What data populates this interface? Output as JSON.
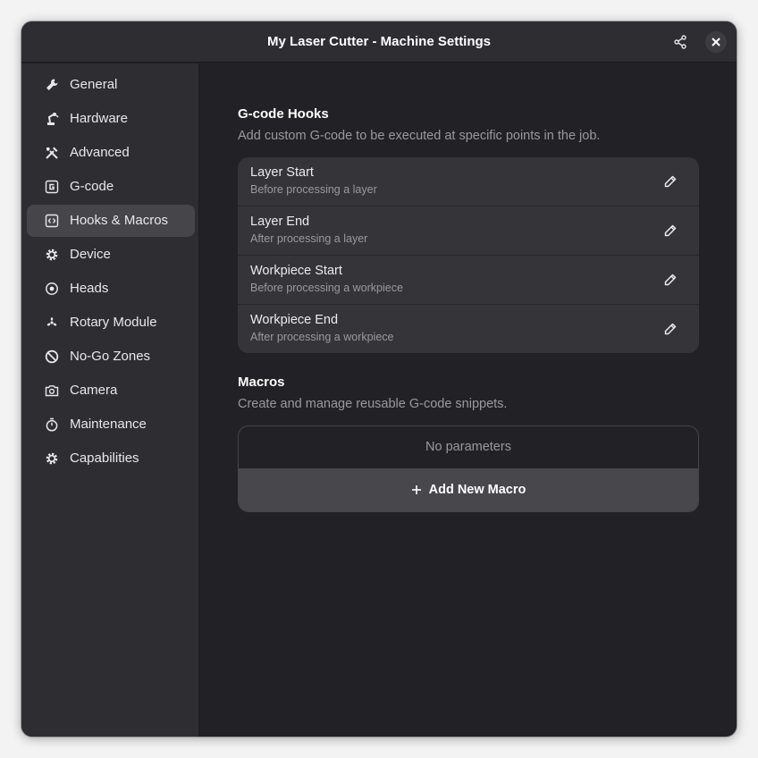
{
  "window": {
    "title": "My Laser Cutter - Machine Settings",
    "share_icon": "share-icon",
    "close_icon": "close-icon"
  },
  "sidebar": {
    "active_index": 4,
    "items": [
      {
        "label": "General",
        "icon": "wrench-icon"
      },
      {
        "label": "Hardware",
        "icon": "robot-arm-icon"
      },
      {
        "label": "Advanced",
        "icon": "tools-icon"
      },
      {
        "label": "G-code",
        "icon": "gcode-icon"
      },
      {
        "label": "Hooks & Macros",
        "icon": "code-brackets-icon"
      },
      {
        "label": "Device",
        "icon": "gear-icon"
      },
      {
        "label": "Heads",
        "icon": "target-icon"
      },
      {
        "label": "Rotary Module",
        "icon": "rotary-icon"
      },
      {
        "label": "No-Go Zones",
        "icon": "prohibited-icon"
      },
      {
        "label": "Camera",
        "icon": "camera-icon"
      },
      {
        "label": "Maintenance",
        "icon": "stopwatch-icon"
      },
      {
        "label": "Capabilities",
        "icon": "gear-icon"
      }
    ]
  },
  "hooks": {
    "title": "G-code Hooks",
    "description": "Add custom G-code to be executed at specific points in the job.",
    "items": [
      {
        "title": "Layer Start",
        "subtitle": "Before processing a layer"
      },
      {
        "title": "Layer End",
        "subtitle": "After processing a layer"
      },
      {
        "title": "Workpiece Start",
        "subtitle": "Before processing a workpiece"
      },
      {
        "title": "Workpiece End",
        "subtitle": "After processing a workpiece"
      }
    ],
    "edit_icon": "pencil-icon"
  },
  "macros": {
    "title": "Macros",
    "description": "Create and manage reusable G-code snippets.",
    "empty_text": "No parameters",
    "add_label": "Add New Macro",
    "add_icon": "plus-icon"
  },
  "colors": {
    "window_bg": "#222226",
    "sidebar_bg": "#2e2e32",
    "active_item_bg": "#45454a",
    "card_bg": "#343439",
    "button_bg": "#47474c",
    "text_primary": "#ffffff",
    "text_secondary": "#9a9a9e"
  }
}
